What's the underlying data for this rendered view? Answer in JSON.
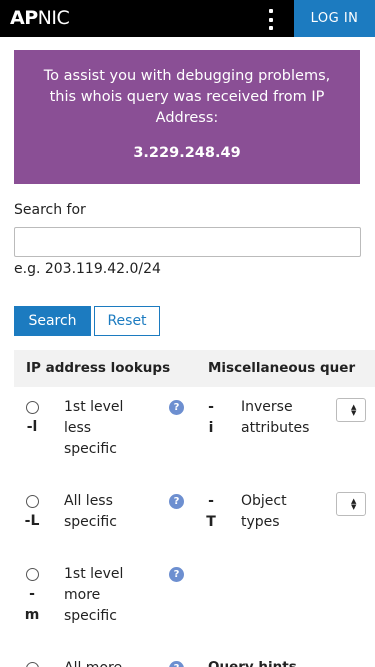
{
  "header": {
    "logo_bold": "AP",
    "logo_regular": "NIC",
    "login_label": "LOG IN"
  },
  "notice": {
    "message": "To assist you with debugging problems, this whois query was received from IP Address:",
    "ip": "3.229.248.49"
  },
  "search": {
    "label": "Search for",
    "value": "",
    "placeholder": "",
    "example": "e.g. 203.119.42.0/24",
    "search_button": "Search",
    "reset_button": "Reset"
  },
  "columns": {
    "ip_lookups": "IP address lookups",
    "misc_queries": "Miscellaneous quer"
  },
  "ip_options": [
    {
      "flag_dash": "-",
      "flag_letter": "l",
      "label_lines": [
        "1st level",
        "less",
        "specific"
      ],
      "help": "?"
    },
    {
      "flag_dash": "-",
      "flag_letter": "L",
      "label_lines": [
        "All less",
        "specific"
      ],
      "help": "?"
    },
    {
      "flag_dash": "-",
      "flag_letter": "m",
      "label_lines": [
        "1st level",
        "more",
        "specific"
      ],
      "help": "?"
    },
    {
      "flag_dash": "",
      "flag_letter": "",
      "label_lines": [
        "All more"
      ],
      "help": "?"
    }
  ],
  "misc_options": [
    {
      "flag_dash": "-",
      "flag_letter": "i",
      "label_lines": [
        "Inverse",
        "attributes"
      ]
    },
    {
      "flag_dash": "-",
      "flag_letter": "T",
      "label_lines": [
        "Object",
        "types"
      ]
    }
  ],
  "misc_next_title": "Query hints",
  "colors": {
    "topbar": "#000000",
    "accent_blue": "#1c7bc0",
    "notice_purple": "#8a4f95",
    "help_icon": "#6d8fd0"
  }
}
